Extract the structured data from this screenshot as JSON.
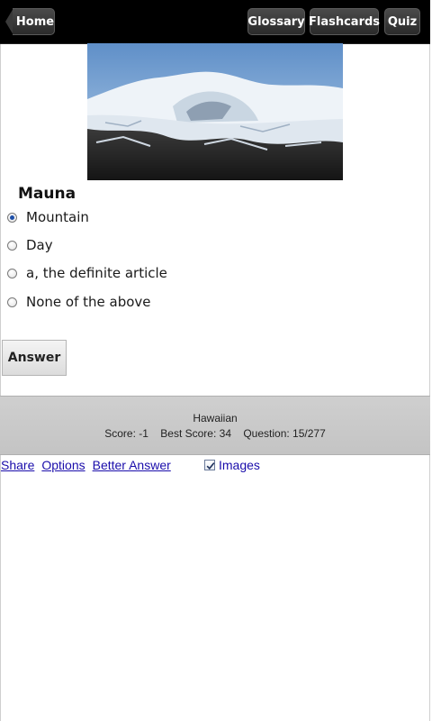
{
  "header": {
    "home_label": "Home",
    "glossary_label": "Glossary",
    "flashcards_label": "Flashcards",
    "quiz_label": "Quiz"
  },
  "quiz": {
    "term": "Mauna",
    "options": [
      {
        "label": "Mountain",
        "selected": true
      },
      {
        "label": "Day",
        "selected": false
      },
      {
        "label": "a, the definite article",
        "selected": false
      },
      {
        "label": "None of the above",
        "selected": false
      }
    ],
    "answer_label": "Answer"
  },
  "status": {
    "language": "Hawaiian",
    "score": "Score: -1",
    "best_score": "Best Score: 34",
    "question": "Question: 15/277"
  },
  "links": {
    "share": "Share",
    "options": "Options",
    "better_answer": "Better Answer",
    "images": "Images",
    "images_checked": true
  },
  "colors": {
    "topbar": "#000000",
    "link": "#1a0dab",
    "footer_band": "#c8c8c8"
  }
}
